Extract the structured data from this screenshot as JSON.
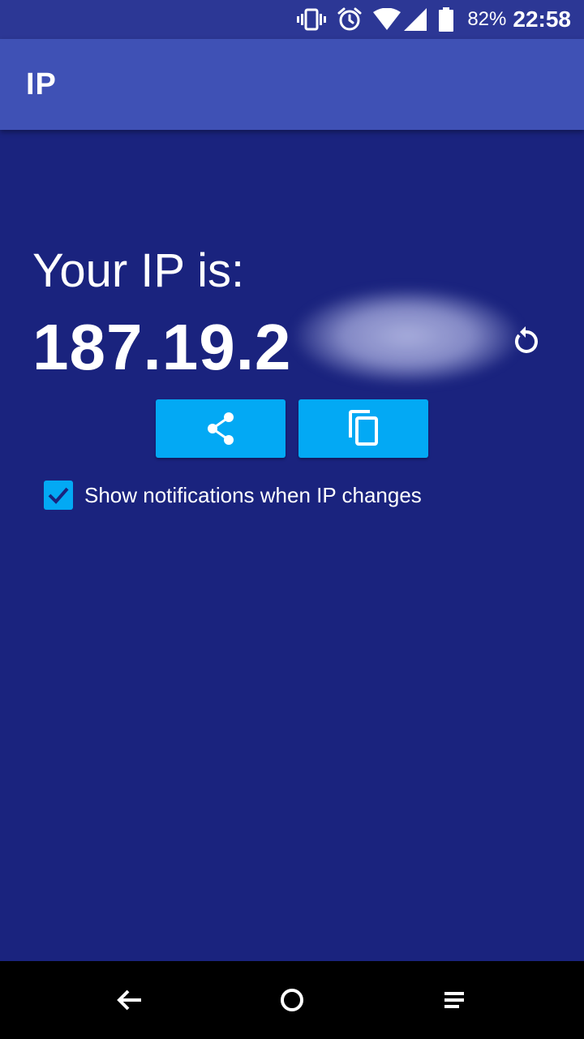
{
  "status_bar": {
    "icons": [
      "vibrate-icon",
      "alarm-icon",
      "wifi-icon",
      "signal-icon",
      "battery-icon"
    ],
    "battery": "82%",
    "time": "22:58"
  },
  "app_bar": {
    "title": "IP"
  },
  "main": {
    "label": "Your IP is:",
    "ip_visible": "187.19.2",
    "ip_obscured": true,
    "refresh_icon": "refresh-icon",
    "share_icon": "share-icon",
    "copy_icon": "copy-icon",
    "notifications_checked": true,
    "notifications_label": "Show notifications when IP changes"
  },
  "nav_bar": {
    "icons": [
      "back-icon",
      "home-icon",
      "recents-icon"
    ]
  },
  "colors": {
    "background": "#1a237e",
    "app_bar": "#3f51b5",
    "status_bar": "#2c3795",
    "accent": "#03a9f4"
  }
}
